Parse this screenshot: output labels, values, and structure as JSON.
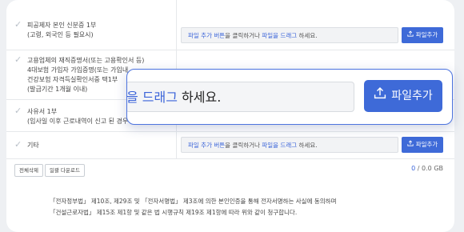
{
  "rows": [
    {
      "lines": [
        "피공제자 본인 신분증 1부",
        "(고령, 외국인 등 필요시)"
      ]
    },
    {
      "lines": [
        "고용업체의 재직증명서(또는 고용확인서 등)",
        "4대보험 가입자 가입증명(또는 가입내",
        "건강보험 자격득실확인서중 택1부",
        "(발급기간 1개월 이내)"
      ]
    },
    {
      "lines": [
        "사유서 1부",
        "(입사일 이후 근로내역이 신고 된 경우"
      ]
    },
    {
      "lines": [
        "기타"
      ]
    }
  ],
  "dropzone": {
    "part1": "파일 추가 버튼",
    "part2": "을 클릭하거나 ",
    "part3": "파일을 드래그",
    "part4": " 하세요."
  },
  "add_file_label": "파일추가",
  "zoom": {
    "drop_blue": "을 드래그",
    "drop_tail": " 하세요.",
    "button_label": "파일추가"
  },
  "buttons": {
    "delete_all": "전체삭제",
    "download_all": "일괄 다운로드"
  },
  "size": {
    "count": "0",
    "total": " / 0.0 GB"
  },
  "consent": {
    "line1": "「전자정부법」 제10조, 제29조 및 「전자서명법」 제3조에 의한 본인인증을 통해 전자서명하는 사실에 동의하며",
    "line2": "「건설근로자법」 제15조 제1항 및 같은 법 시행규칙 제19조 제1항에 따라 위와 같이 청구합니다."
  },
  "colors": {
    "accent": "#3e6ad8",
    "link": "#3b64d9"
  }
}
